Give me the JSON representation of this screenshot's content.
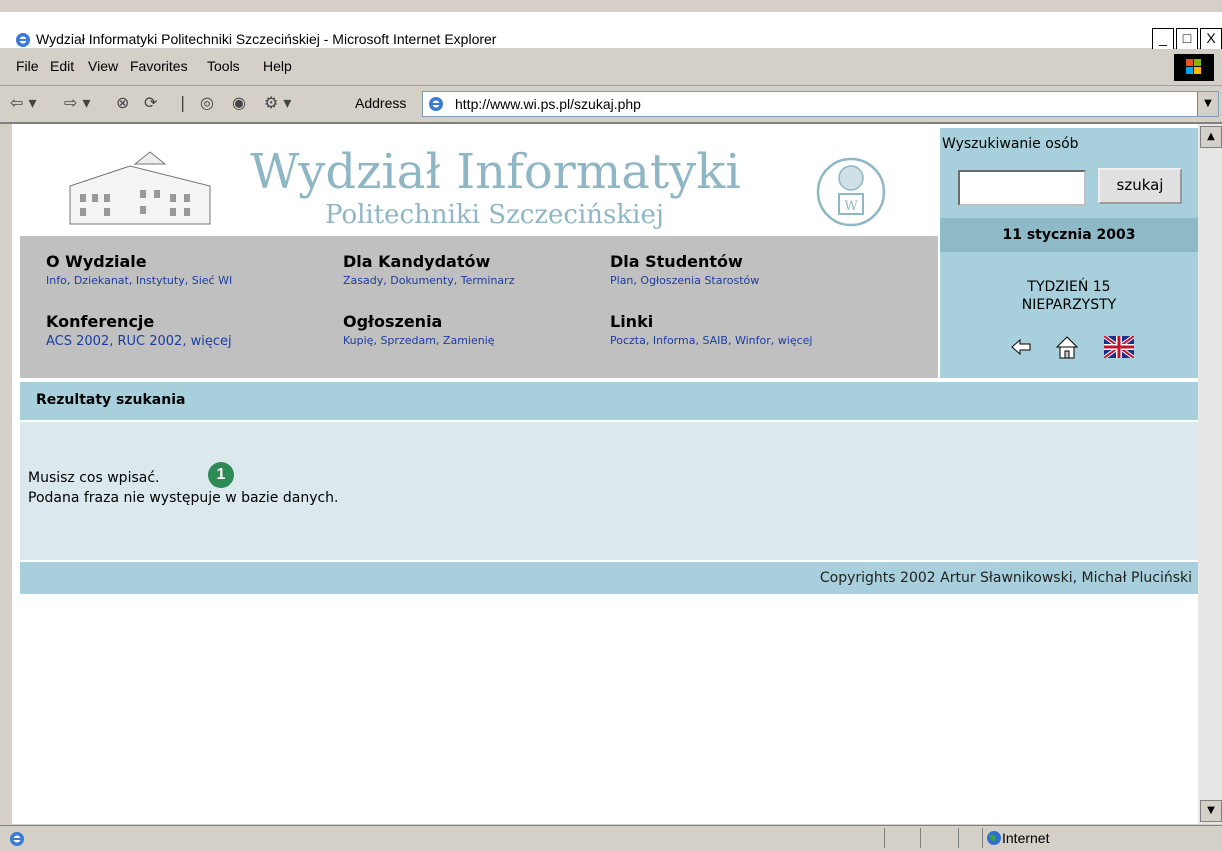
{
  "window": {
    "title": "Wydział Informatyki Politechniki Szczecińskiej - Microsoft Internet Explorer",
    "controls": [
      "_",
      "□",
      "X"
    ]
  },
  "menu": [
    "File",
    "Edit",
    "View",
    "Favorites",
    "Tools",
    "Help"
  ],
  "address": {
    "label": "Address",
    "url": "http://www.wi.ps.pl/szukaj.php"
  },
  "header": {
    "title": "Wydział Informatyki",
    "subtitle": "Politechniki Szczecińskiej"
  },
  "search": {
    "title": "Wyszukiwanie osób",
    "button": "szukaj",
    "value": ""
  },
  "date": "11 stycznia 2003",
  "week": {
    "line1": "TYDZIEŃ 15",
    "line2": "NIEPARZYSTY"
  },
  "nav": [
    {
      "heading": "O Wydziale",
      "links": [
        "Info",
        "Dziekanat",
        "Instytuty",
        "Sieć WI"
      ]
    },
    {
      "heading": "Dla Kandydatów",
      "links": [
        "Zasady",
        "Dokumenty",
        "Terminarz"
      ]
    },
    {
      "heading": "Dla Studentów",
      "links": [
        "Plan",
        "Ogłoszenia Starostów"
      ]
    },
    {
      "heading": "Konferencje",
      "links": [
        "ACS 2002",
        "RUC 2002",
        "więcej"
      ]
    },
    {
      "heading": "Ogłoszenia",
      "links": [
        "Kupię",
        "Sprzedam",
        "Zamienię"
      ]
    },
    {
      "heading": "Linki",
      "links": [
        "Poczta",
        "Informa",
        "SAIB",
        "Winfor",
        "więcej"
      ]
    }
  ],
  "results": {
    "heading": "Rezultaty szukania",
    "line1": "Musisz cos wpisać.",
    "line2": "Podana fraza nie występuje w bazie danych.",
    "badge": "1"
  },
  "footer": "Copyrights 2002 Artur Sławnikowski, Michał Pluciński",
  "status": {
    "zone": "Internet"
  },
  "colors": {
    "panel": "#a8d0dc",
    "nav": "#c0c0c0",
    "link": "#1a3da0",
    "logo": "#8fb6c4",
    "badge": "#2e8a55"
  }
}
